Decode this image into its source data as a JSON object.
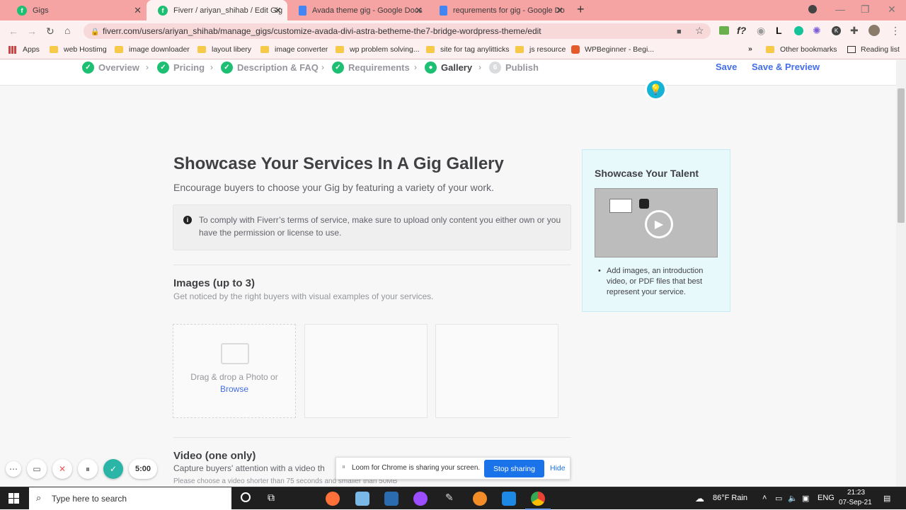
{
  "browser": {
    "tabs": [
      {
        "title": "Gigs",
        "favicon": "fiverr-icon"
      },
      {
        "title": "Fiverr / ariyan_shihab / Edit Gig",
        "favicon": "fiverr-icon"
      },
      {
        "title": "Avada theme gig - Google Docs",
        "favicon": "docs-icon"
      },
      {
        "title": "requrements for gig - Google Do",
        "favicon": "docs-icon"
      }
    ],
    "new_tab": "+",
    "url": "fiverr.com/users/ariyan_shihab/manage_gigs/customize-avada-divi-astra-betheme-the7-bridge-wordpress-theme/edit",
    "bookmarks": [
      "Apps",
      "web Hostimg",
      "image downloader",
      "layout libery",
      "image converter",
      "wp problem solving...",
      "site for tag anylitticks",
      "js resource",
      "WPBeginner - Begi..."
    ],
    "more_bookmarks": "»",
    "other_bookmarks": "Other bookmarks",
    "reading_list": "Reading list",
    "ext_fx": "f?",
    "ext_l": "L",
    "ext_k": "K"
  },
  "steps": {
    "items": [
      {
        "label": "Overview",
        "state": "done"
      },
      {
        "label": "Pricing",
        "state": "done"
      },
      {
        "label": "Description & FAQ",
        "state": "done"
      },
      {
        "label": "Requirements",
        "state": "done"
      },
      {
        "label": "Gallery",
        "state": "current"
      },
      {
        "label": "Publish",
        "state": "pending",
        "number": "6"
      }
    ],
    "save": "Save",
    "save_preview": "Save & Preview"
  },
  "gallery": {
    "title": "Showcase Your Services In A Gig Gallery",
    "subtitle": "Encourage buyers to choose your Gig by featuring a variety of your work.",
    "notice": "To comply with Fiverr’s terms of service, make sure to upload only content you either own or you have the permission or license to use.",
    "images_title": "Images (up to 3)",
    "images_sub": "Get noticed by the right buyers with visual examples of your services.",
    "drop_text": "Drag & drop a Photo or",
    "browse": "Browse",
    "video_title": "Video (one only)",
    "video_sub": "Capture buyers' attention with a video th",
    "video_note": "Please choose a video shorter than 75 seconds and smaller than 50MB"
  },
  "talent": {
    "title": "Showcase Your Talent",
    "bullet": "Add images, an introduction video, or PDF files that best represent your service."
  },
  "loom": {
    "timer": "5:00",
    "share_text": "Loom for Chrome is sharing your screen.",
    "stop": "Stop sharing",
    "hide": "Hide"
  },
  "taskbar": {
    "search_placeholder": "Type here to search",
    "weather": "86°F  Rain",
    "lang": "ENG",
    "time": "21:23",
    "date": "07-Sep-21"
  },
  "colors": {
    "fiverr_green": "#1dbf73",
    "link_blue": "#446ee7",
    "tab_strip": "#f5a3a3"
  }
}
